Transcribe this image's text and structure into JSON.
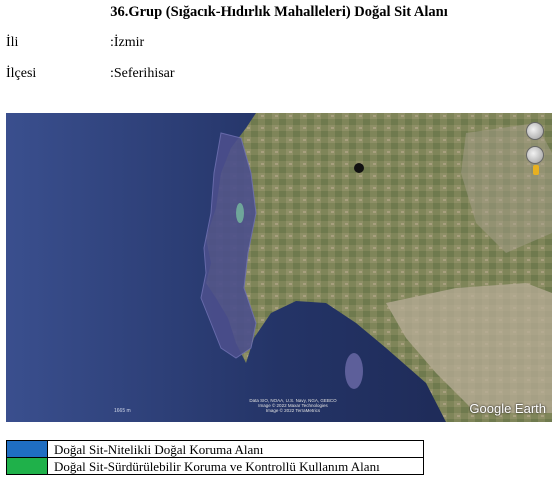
{
  "title": "36.Grup (Sığacık-Hıdırlık Mahalleleri) Doğal Sit Alanı",
  "info": [
    {
      "label": "İli",
      "value": ":İzmir"
    },
    {
      "label": "İlçesi",
      "value": ":Seferihisar"
    }
  ],
  "map": {
    "attribution_lines": [
      "Data SIO, NOAA, U.S. Navy, NGA, GEBCO",
      "Image © 2022 Maxar Technologies",
      "Image © 2022 TerraMetrics"
    ],
    "scale_text": "1665 m",
    "logo": "Google Earth",
    "controls": [
      "compass-icon",
      "zoom-icon",
      "pegman-icon"
    ]
  },
  "legend": [
    {
      "color": "#1f6ec2",
      "label": "Doğal Sit-Nitelikli Doğal Koruma Alanı"
    },
    {
      "color": "#1fb14a",
      "label": "Doğal Sit-Sürdürülebilir Koruma ve Kontrollü Kullanım Alanı"
    }
  ]
}
